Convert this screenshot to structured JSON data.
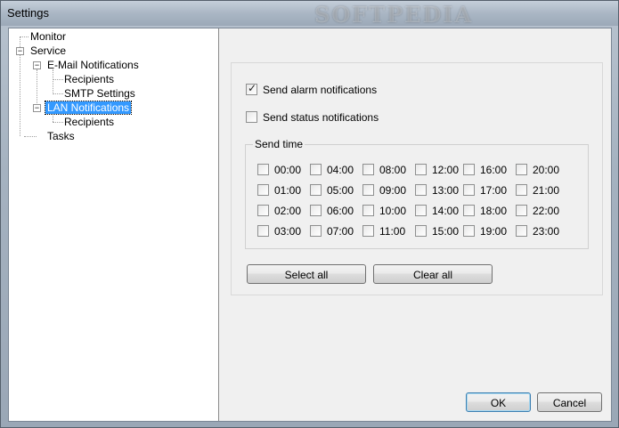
{
  "window": {
    "title": "Settings",
    "watermark": "SOFTPEDIA"
  },
  "tree": {
    "monitor": "Monitor",
    "service": "Service",
    "email": "E-Mail Notifications",
    "email_recipients": "Recipients",
    "smtp": "SMTP  Settings",
    "lan": "LAN Notifications",
    "lan_recipients": "Recipients",
    "tasks": "Tasks"
  },
  "panel": {
    "alarm_label": "Send alarm notifications",
    "alarm_checked": true,
    "status_label": "Send status notifications",
    "status_checked": false,
    "send_time_label": "Send time",
    "times": [
      [
        "00:00",
        "04:00",
        "08:00",
        "12:00",
        "16:00",
        "20:00"
      ],
      [
        "01:00",
        "05:00",
        "09:00",
        "13:00",
        "17:00",
        "21:00"
      ],
      [
        "02:00",
        "06:00",
        "10:00",
        "14:00",
        "18:00",
        "22:00"
      ],
      [
        "03:00",
        "07:00",
        "11:00",
        "15:00",
        "19:00",
        "23:00"
      ]
    ],
    "select_all": "Select all",
    "clear_all": "Clear all"
  },
  "buttons": {
    "ok": "OK",
    "cancel": "Cancel"
  }
}
